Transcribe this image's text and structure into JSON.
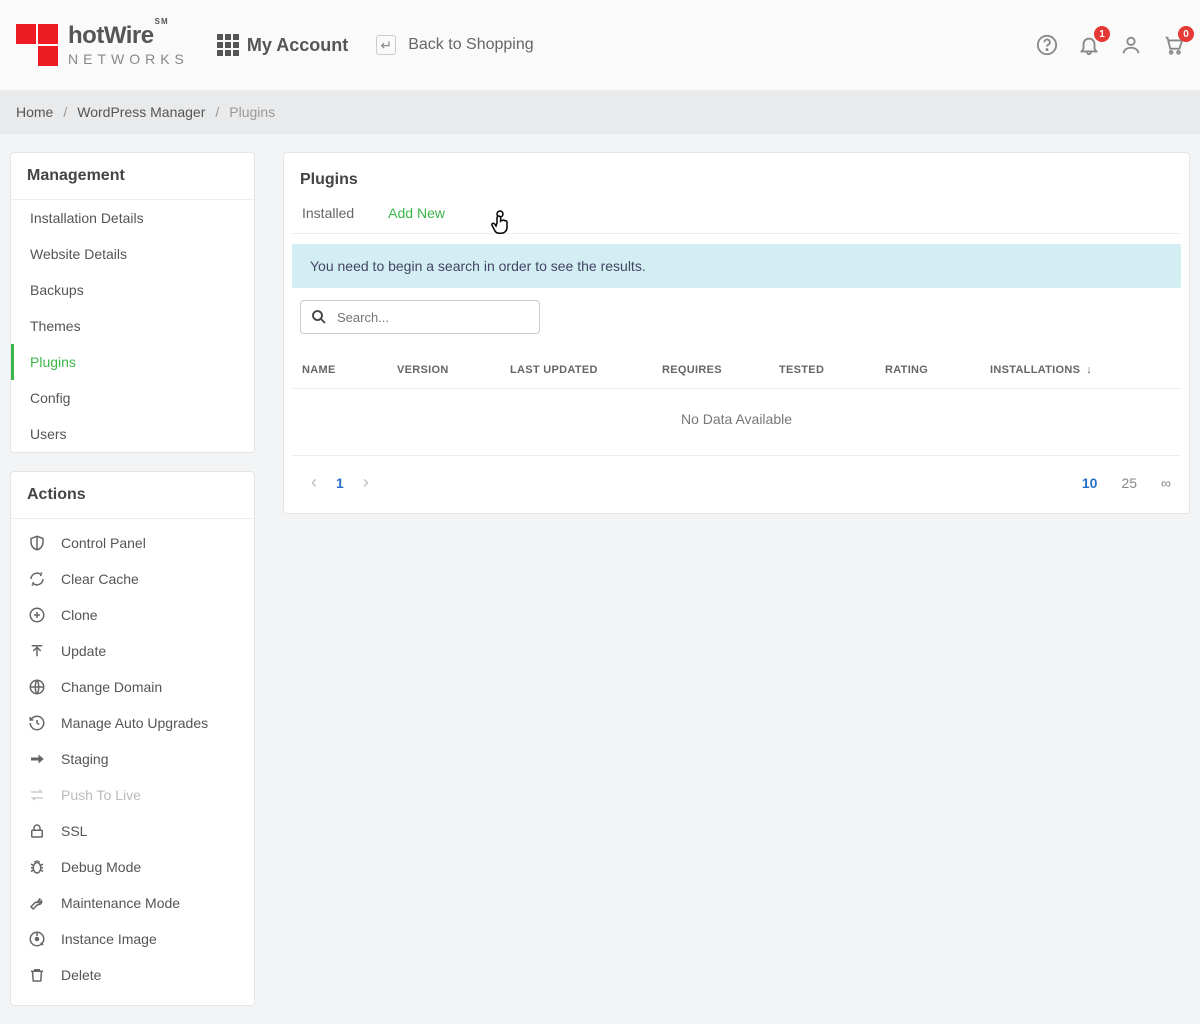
{
  "header": {
    "brand": "hotWire",
    "brand_sup": "SM",
    "brand_sub": "NETWORKS",
    "my_account": "My Account",
    "back_to_shopping": "Back to Shopping",
    "badge_notifications": "1",
    "badge_cart": "0"
  },
  "breadcrumb": {
    "home": "Home",
    "section": "WordPress Manager",
    "current": "Plugins"
  },
  "sidebar": {
    "management_title": "Management",
    "nav": [
      {
        "label": "Installation Details"
      },
      {
        "label": "Website Details"
      },
      {
        "label": "Backups"
      },
      {
        "label": "Themes"
      },
      {
        "label": "Plugins"
      },
      {
        "label": "Config"
      },
      {
        "label": "Users"
      }
    ],
    "actions_title": "Actions",
    "actions": [
      {
        "label": "Control Panel"
      },
      {
        "label": "Clear Cache"
      },
      {
        "label": "Clone"
      },
      {
        "label": "Update"
      },
      {
        "label": "Change Domain"
      },
      {
        "label": "Manage Auto Upgrades"
      },
      {
        "label": "Staging"
      },
      {
        "label": "Push To Live"
      },
      {
        "label": "SSL"
      },
      {
        "label": "Debug Mode"
      },
      {
        "label": "Maintenance Mode"
      },
      {
        "label": "Instance Image"
      },
      {
        "label": "Delete"
      }
    ]
  },
  "main": {
    "title": "Plugins",
    "tabs": {
      "installed": "Installed",
      "add_new": "Add New"
    },
    "notice": "You need to begin a search in order to see the results.",
    "search_placeholder": "Search...",
    "columns": {
      "name": "NAME",
      "version": "VERSION",
      "last_updated": "LAST UPDATED",
      "requires": "REQUIRES",
      "tested": "TESTED",
      "rating": "RATING",
      "installations": "INSTALLATIONS"
    },
    "no_data": "No Data Available",
    "paginator": {
      "page": "1",
      "size_10": "10",
      "size_25": "25",
      "size_inf": "∞"
    }
  }
}
